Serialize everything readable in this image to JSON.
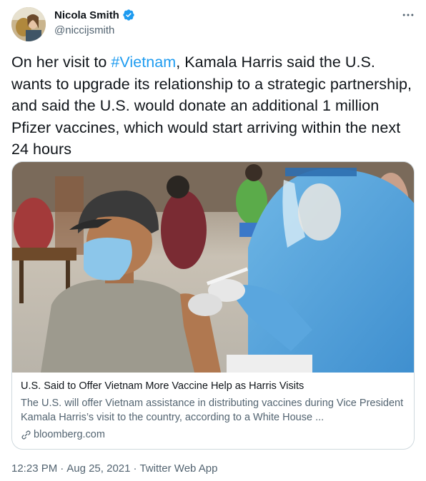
{
  "author": {
    "display_name": "Nicola Smith",
    "handle": "@niccijsmith",
    "verified": true
  },
  "tweet": {
    "text_before": "On her visit to ",
    "hashtag": "#Vietnam",
    "text_after": ", Kamala Harris said the U.S. wants to upgrade its relationship to a strategic partnership, and said the U.S. would donate an additional 1 million Pfizer vaccines, which would start arriving within the next 24 hours"
  },
  "card": {
    "title": "U.S. Said to Offer Vietnam More Vaccine Help as Harris Visits",
    "description": "The U.S. will offer Vietnam assistance in distributing vaccines during Vice President Kamala Harris’s visit to the country, according to a White House ...",
    "source": "bloomberg.com"
  },
  "meta": {
    "time": "12:23 PM",
    "separator": "·",
    "date": "Aug 25, 2021",
    "client": "Twitter Web App"
  },
  "icons": {
    "verified": "verified-badge-icon",
    "more": "more-horizontal-icon",
    "link": "link-icon"
  },
  "colors": {
    "accent": "#1d9bf0",
    "text": "#0f1419",
    "secondary": "#536471",
    "border": "#cfd9de"
  }
}
